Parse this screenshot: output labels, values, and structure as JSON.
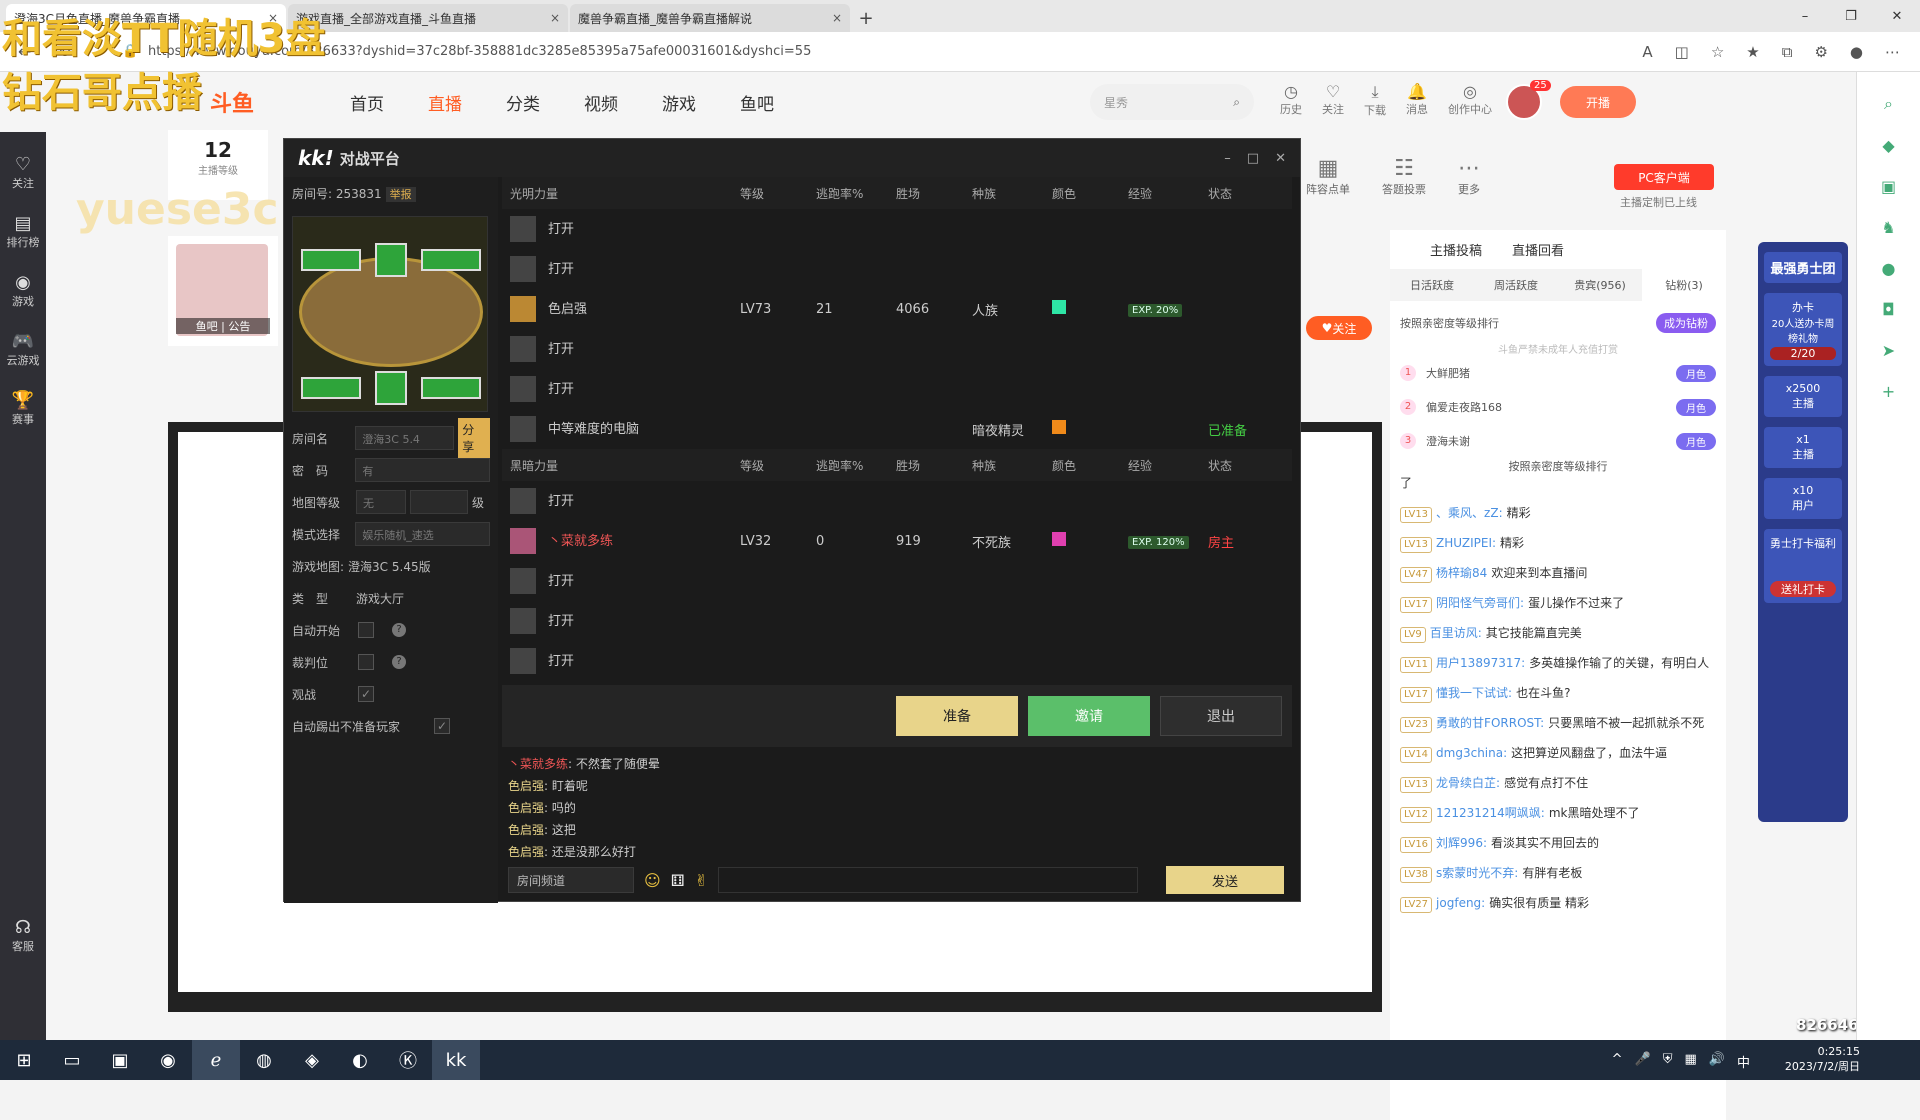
{
  "browser": {
    "tabs": [
      {
        "label": "澄海3C月色直播_魔兽争霸直播",
        "close": "×"
      },
      {
        "label": "游戏直播_全部游戏直播_斗鱼直播",
        "close": "×"
      },
      {
        "label": "魔兽争霸直播_魔兽争霸直播解说",
        "close": "×"
      }
    ],
    "new_tab": "+",
    "url": "https://www.douyu.com/826633?dyshid=37c28bf-358881dc3285e85395a75afe00031601&dyshci=55"
  },
  "overlay": {
    "line1": "和看淡TT随机3盘",
    "line2": "钻石哥点播",
    "watermark": "yuese3c",
    "watermark2": "yuese3c"
  },
  "site": {
    "logo": "斗鱼",
    "nav": [
      "首页",
      "直播",
      "分类",
      "视频",
      "游戏",
      "鱼吧"
    ],
    "search_placeholder": "星秀",
    "top_icons": [
      "历史",
      "关注",
      "下载",
      "消息",
      "创作中心"
    ],
    "avatar_badge": "25",
    "kaibo": "开播",
    "left_menu": [
      "关注",
      "排行榜",
      "游戏",
      "云游戏",
      "赛事",
      "客服"
    ],
    "info_count": "12",
    "info_label": "主播等级",
    "fishbar_label": "鱼吧",
    "notice_label": "公告",
    "follow_btn": "关注",
    "toolbar": [
      "阵容点单",
      "答题投票",
      "更多"
    ],
    "pc_btn": "PC客户端",
    "pc_sub": "主播定制已上线"
  },
  "right_panel": {
    "top_tabs": [
      "主播投稿",
      "直播回看"
    ],
    "sub_tabs": [
      "日活跃度",
      "周活跃度",
      "贵宾(956)",
      "钻粉(3)"
    ],
    "rank_title": "按照亲密度等级排行",
    "become_fan": "成为钻粉",
    "rank_note": "斗鱼严禁未成年人充值打赏",
    "rank": [
      {
        "n": "1",
        "name": "大鲜肥猪",
        "tag": "月色"
      },
      {
        "n": "2",
        "name": "偏爱走夜路168",
        "tag": "月色"
      },
      {
        "n": "3",
        "name": "澄海未谢",
        "tag": "月色"
      }
    ],
    "rank_footer": "按照亲密度等级排行",
    "chat": [
      {
        "lv": "",
        "user": "",
        "msg": "了"
      },
      {
        "lv": "LV13",
        "user": "、乘风、zZ:",
        "msg": "精彩"
      },
      {
        "lv": "LV13",
        "user": "ZHUZIPEI:",
        "msg": "精彩"
      },
      {
        "lv": "LV47",
        "user": "杨梓瑜84",
        "msg": "欢迎来到本直播间"
      },
      {
        "lv": "LV17",
        "user": "阴阳怪气旁哥们:",
        "msg": "蛋儿操作不过来了"
      },
      {
        "lv": "LV9",
        "user": "百里访风:",
        "msg": "其它技能篇直完美"
      },
      {
        "lv": "LV11",
        "user": "用户13897317:",
        "msg": "多英雄操作输了的关键，有明白人"
      },
      {
        "lv": "LV17",
        "user": "懂我一下试试:",
        "msg": "也在斗鱼?"
      },
      {
        "lv": "LV23",
        "user": "勇敢的甘FORROST:",
        "msg": "只要黑暗不被一起抓就杀不死"
      },
      {
        "lv": "LV14",
        "user": "dmg3china:",
        "msg": "这把算逆风翻盘了，血法牛逼"
      },
      {
        "lv": "LV13",
        "user": "龙骨续白芷:",
        "msg": "感觉有点打不住"
      },
      {
        "lv": "LV12",
        "user": "121231214啊飒飒:",
        "msg": "mk黑暗处理不了"
      },
      {
        "lv": "LV16",
        "user": "刘辉996:",
        "msg": "看淡其实不用回去的"
      },
      {
        "lv": "LV38",
        "user": "s索蒙时光不弃:",
        "msg": "有胖有老板"
      },
      {
        "lv": "LV27",
        "user": "jogfeng:",
        "msg": "确实很有质量 精彩"
      }
    ]
  },
  "promo": {
    "title": "最强勇士团",
    "card": "办卡",
    "desc": "20人送办卡周榜礼物",
    "progress": "2/20",
    "x2500": "x2500",
    "l1": "主播",
    "x1": "x1",
    "l2": "主播",
    "x10": "x10",
    "l3": "用户",
    "daka": "勇士打卡福利",
    "send": "送礼打卡"
  },
  "kk": {
    "logo": "kk!",
    "platform": "对战平台",
    "room_id_label": "房间号: 253831",
    "report": "举报",
    "room_name_label": "房间名",
    "room_name_value": "澄海3C 5.4",
    "share": "分享",
    "password_label": "密　码",
    "password_value": "有",
    "map_level_label": "地图等级",
    "map_level_value": "无",
    "level_suffix": "级",
    "mode_label": "模式选择",
    "mode_value": "娱乐随机_速选",
    "game_map_label": "游戏地图:",
    "game_map_value": "澄海3C 5.45版",
    "type_label": "类　型",
    "type_value": "游戏大厅",
    "auto_start": "自动开始",
    "referee": "裁判位",
    "spectate": "观战",
    "auto_kick": "自动踢出不准备玩家",
    "columns_light": [
      "光明力量",
      "等级",
      "逃跑率%",
      "胜场",
      "种族",
      "颜色",
      "经验",
      "状态"
    ],
    "columns_dark": [
      "黑暗力量",
      "等级",
      "逃跑率%",
      "胜场",
      "种族",
      "颜色",
      "经验",
      "状态"
    ],
    "light_rows": [
      {
        "name": "打开"
      },
      {
        "name": "打开"
      },
      {
        "name": "色启强",
        "lv": "LV73",
        "flee": "21",
        "win": "4066",
        "race": "人族",
        "color": "#2ee6a6",
        "exp": "EXP. 20%",
        "status": ""
      },
      {
        "name": "打开"
      },
      {
        "name": "打开"
      },
      {
        "name": "中等难度的电脑",
        "race": "暗夜精灵",
        "color": "#f08a1a",
        "status": "已准备"
      }
    ],
    "dark_rows": [
      {
        "name": "打开"
      },
      {
        "name": "丶菜就多练",
        "lv": "LV32",
        "flee": "0",
        "win": "919",
        "race": "不死族",
        "color": "#e040b0",
        "exp": "EXP. 120%",
        "status": "房主"
      },
      {
        "name": "打开"
      },
      {
        "name": "打开"
      },
      {
        "name": "打开"
      }
    ],
    "buttons": {
      "ready": "准备",
      "invite": "邀请",
      "exit": "退出"
    },
    "chat": [
      {
        "name": "丶菜就多练",
        "msg": ": 不然套了随便晕"
      },
      {
        "name": "色启强",
        "msg": ": 盯着呢"
      },
      {
        "name": "色启强",
        "msg": ": 吗的"
      },
      {
        "name": "色启强",
        "msg": ": 这把"
      },
      {
        "name": "色启强",
        "msg": ": 还是没那么好打"
      }
    ],
    "channel": "房间频道",
    "send": "发送"
  },
  "taskbar": {
    "time": "0:25:15",
    "date": "2023/7/2/周日",
    "ime": "中",
    "viewers": "826646"
  }
}
